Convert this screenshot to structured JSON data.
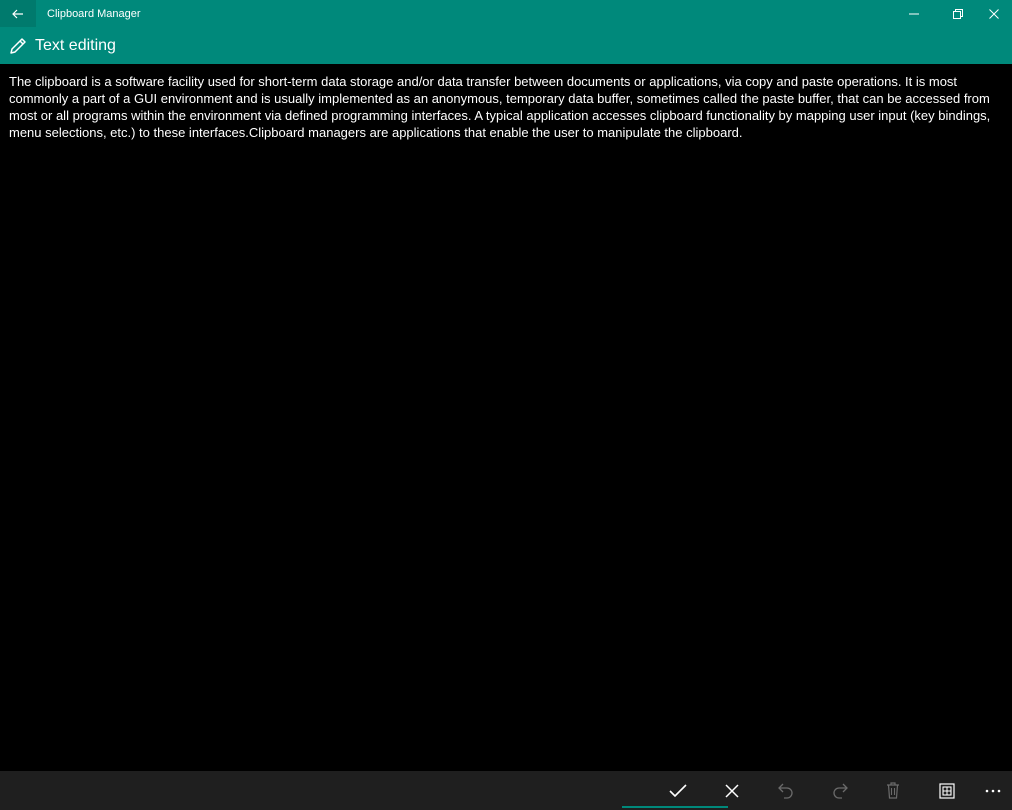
{
  "window": {
    "title": "Clipboard Manager"
  },
  "header": {
    "title": "Text editing"
  },
  "editor": {
    "text": "The clipboard is a software facility used for short-term data storage and/or data transfer between documents or applications, via copy and paste operations. It is most commonly a part of a GUI environment and is usually implemented as an anonymous, temporary data buffer, sometimes called the paste buffer, that can be accessed from most or all programs within the environment via defined programming interfaces. A typical application accesses clipboard functionality by mapping user input (key bindings, menu selections, etc.) to these interfaces.Clipboard managers are applications that enable the user to manipulate the clipboard."
  },
  "commandbar": {
    "items": [
      {
        "icon": "checkmark-icon",
        "enabled": true
      },
      {
        "icon": "close-icon",
        "enabled": true
      },
      {
        "icon": "undo-icon",
        "enabled": false
      },
      {
        "icon": "redo-icon",
        "enabled": false
      },
      {
        "icon": "trash-icon",
        "enabled": false
      },
      {
        "icon": "select-all-icon",
        "enabled": true
      },
      {
        "icon": "more-icon",
        "enabled": true
      }
    ]
  },
  "colors": {
    "accent": "#00897b",
    "background": "#000000",
    "commandbar": "#1f1f1f",
    "text": "#ffffff",
    "disabled_icon": "#6b6b6b"
  }
}
